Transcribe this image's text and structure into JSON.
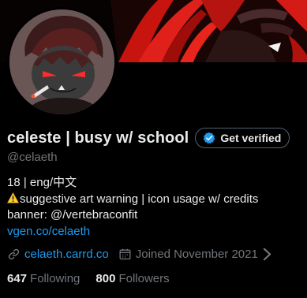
{
  "profile": {
    "display_name": "celeste | busy w/ school",
    "verify_button": "Get verified",
    "handle": "@celaeth",
    "bio": {
      "line1": "18 | eng/中文",
      "line2": "suggestive art warning | icon usage w/ credits",
      "line3": "banner: @/vertebraconfit",
      "link": "vgen.co/celaeth"
    },
    "website": "celaeth.carrd.co",
    "joined": "Joined November 2021",
    "following_count": "647",
    "following_label": "Following",
    "followers_count": "800",
    "followers_label": "Followers"
  },
  "colors": {
    "background": "#000000",
    "text": "#e7e9ea",
    "muted": "#71767b",
    "link": "#1d9bf0",
    "banner_red": "#e0201a"
  },
  "icons": {
    "verify": "verified-check-icon",
    "warning": "warning-sign-icon",
    "website": "link-icon",
    "joined": "calendar-icon",
    "more": "chevron-right-icon"
  }
}
